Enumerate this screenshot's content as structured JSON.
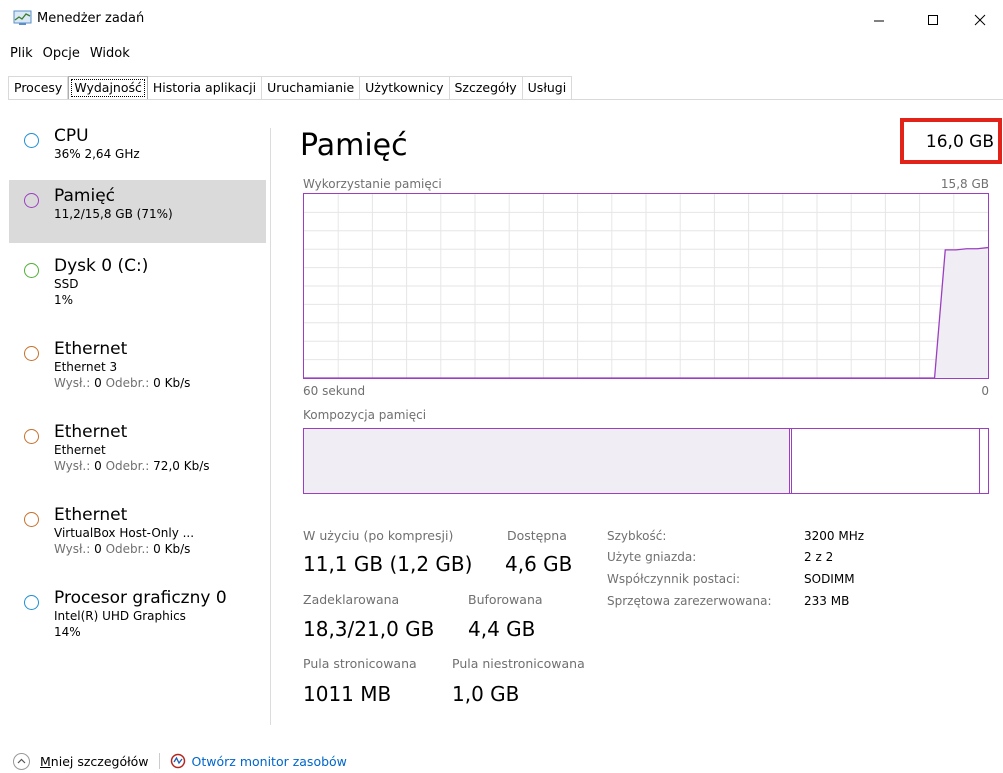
{
  "window": {
    "title": "Menedżer zadań",
    "minimize_glyph": "—",
    "maximize_glyph": "☐",
    "close_glyph": "✕"
  },
  "menu": {
    "file": "Plik",
    "options": "Opcje",
    "view": "Widok"
  },
  "tabs": [
    {
      "label": "Procesy"
    },
    {
      "label": "Wydajność"
    },
    {
      "label": "Historia aplikacji"
    },
    {
      "label": "Uruchamianie"
    },
    {
      "label": "Użytkownicy"
    },
    {
      "label": "Szczegóły"
    },
    {
      "label": "Usługi"
    }
  ],
  "active_tab": "Wydajność",
  "sidebar": {
    "items": [
      {
        "title": "CPU",
        "line1": "36% 2,64 GHz",
        "color": "#1e8fd6"
      },
      {
        "title": "Pamięć",
        "line1": "11,2/15,8 GB (71%)",
        "color": "#9b3fc1"
      },
      {
        "title": "Dysk 0 (C:)",
        "line1": "SSD",
        "line2": "1%",
        "color": "#4fb035"
      },
      {
        "title": "Ethernet",
        "line1": "Ethernet 3",
        "send_label": "Wysł.:",
        "send": "0",
        "recv_label": "Odebr.:",
        "recv": "0 Kb/s",
        "color": "#c8702b"
      },
      {
        "title": "Ethernet",
        "line1": "Ethernet",
        "send_label": "Wysł.:",
        "send": "0",
        "recv_label": "Odebr.:",
        "recv": "72,0 Kb/s",
        "color": "#c8702b"
      },
      {
        "title": "Ethernet",
        "line1": "VirtualBox Host-Only ...",
        "send_label": "Wysł.:",
        "send": "0",
        "recv_label": "Odebr.:",
        "recv": "0 Kb/s",
        "color": "#c8702b"
      },
      {
        "title": "Procesor graficzny 0",
        "line1": "Intel(R) UHD Graphics",
        "line2": "14%",
        "color": "#1e8fd6"
      }
    ]
  },
  "main": {
    "title": "Pamięć",
    "total": "16,0 GB",
    "usage_label": "Wykorzystanie pamięci",
    "usage_max": "15,8 GB",
    "time_left": "60 sekund",
    "time_right": "0",
    "composition_label": "Kompozycja pamięci"
  },
  "usage_graph": {
    "line_color": "#9b3fc1",
    "fill_color": "#f1edf4",
    "grid_color": "#e6e6e6",
    "y_max": 15.8,
    "points": [
      [
        0,
        0
      ],
      [
        10,
        0
      ],
      [
        20,
        0
      ],
      [
        30,
        0
      ],
      [
        40,
        0
      ],
      [
        50,
        0
      ],
      [
        58,
        0
      ],
      [
        59,
        0
      ],
      [
        60,
        11.0
      ],
      [
        61,
        11.0
      ],
      [
        62,
        11.1
      ],
      [
        63,
        11.1
      ],
      [
        64,
        11.2
      ]
    ],
    "total_seconds": 64
  },
  "composition": {
    "in_use_fraction": 0.71,
    "modified_fraction": 0.003,
    "standby_fraction": 0.275,
    "free_fraction": 0.012,
    "fill_color": "#f1edf4",
    "border_color": "#9b3fc1"
  },
  "stats": {
    "in_use_label": "W użyciu (po kompresji)",
    "in_use": "11,1 GB (1,2 GB)",
    "available_label": "Dostępna",
    "available": "4,6 GB",
    "committed_label": "Zadeklarowana",
    "committed": "18,3/21,0 GB",
    "cached_label": "Buforowana",
    "cached": "4,4 GB",
    "paged_label": "Pula stronicowana",
    "paged": "1011 MB",
    "nonpaged_label": "Pula niestronicowana",
    "nonpaged": "1,0 GB"
  },
  "details": [
    {
      "key": "Szybkość:",
      "value": "3200 MHz"
    },
    {
      "key": "Użyte gniazda:",
      "value": "2 z 2"
    },
    {
      "key": "Współczynnik postaci:",
      "value": "SODIMM"
    },
    {
      "key": "Sprzętowa zarezerwowana:",
      "value": "233 MB"
    }
  ],
  "footer": {
    "less_details_accel": "M",
    "less_details_rest": "niej szczegółów",
    "resource_monitor": "Otwórz monitor zasobów"
  },
  "highlight_color": "#e2231a"
}
